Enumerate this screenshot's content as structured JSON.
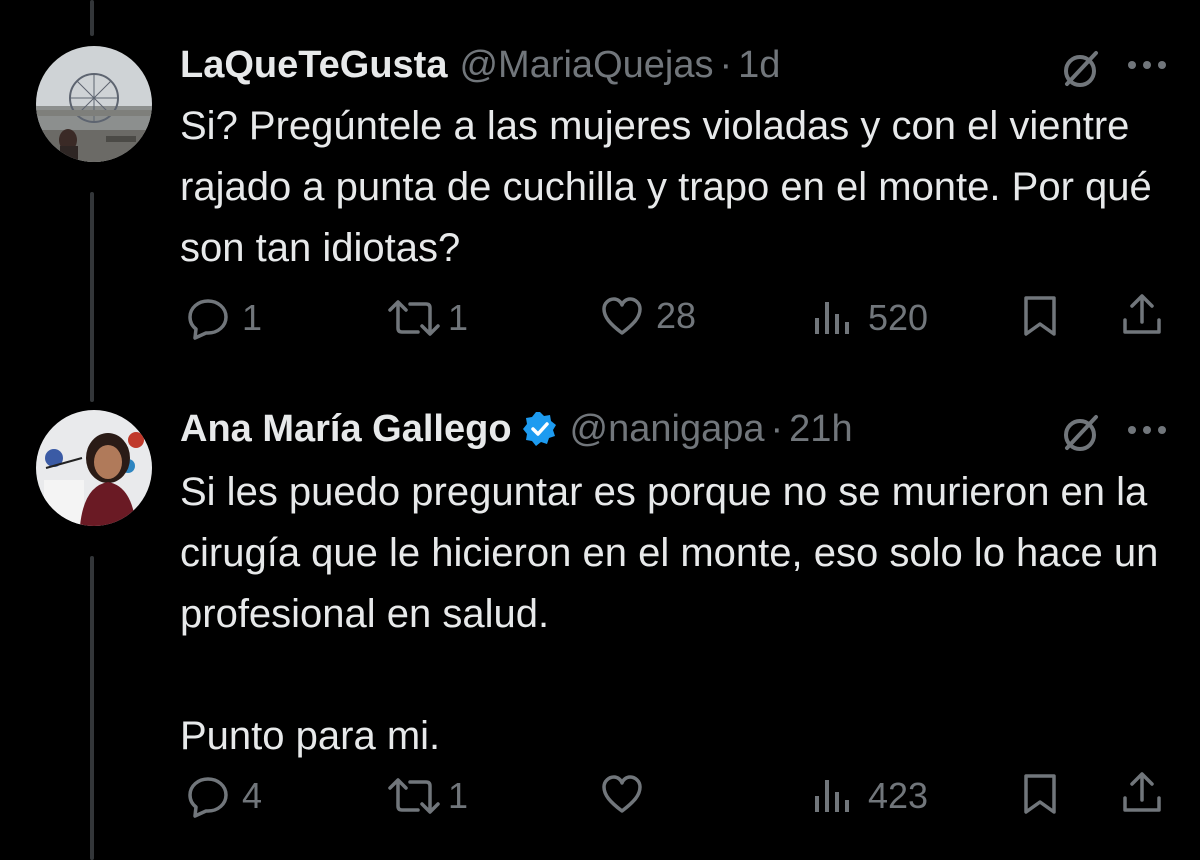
{
  "tweets": [
    {
      "name": "LaQueTeGusta",
      "verified": false,
      "handle": "@MariaQuejas",
      "separator": "·",
      "time": "1d",
      "text": "Si? Pregúntele a las mujeres violadas y con el vientre rajado a punta de cuchilla y trapo en el monte. Por qué son tan idiotas?",
      "replies": "1",
      "reposts": "1",
      "likes": "28",
      "views": "520"
    },
    {
      "name": "Ana María Gallego",
      "verified": true,
      "handle": "@nanigapa",
      "separator": "·",
      "time": "21h",
      "text": "Si les puedo preguntar es porque no se murieron en la cirugía que le hicieron en el monte, eso solo lo hace un profesional en salud.\n\nPunto para mi.",
      "replies": "4",
      "reposts": "1",
      "likes": "",
      "views": "423"
    }
  ],
  "icons": {
    "reply": "reply-icon",
    "repost": "repost-icon",
    "like": "heart-icon",
    "views": "views-icon",
    "bookmark": "bookmark-icon",
    "share": "share-icon",
    "grok": "grok-icon",
    "more": "more-icon",
    "verified": "verified-badge-icon"
  },
  "colors": {
    "background": "#000000",
    "text": "#e7e9ea",
    "secondary": "#71767b",
    "verified": "#1d9bf0",
    "thread_line": "#333639"
  }
}
